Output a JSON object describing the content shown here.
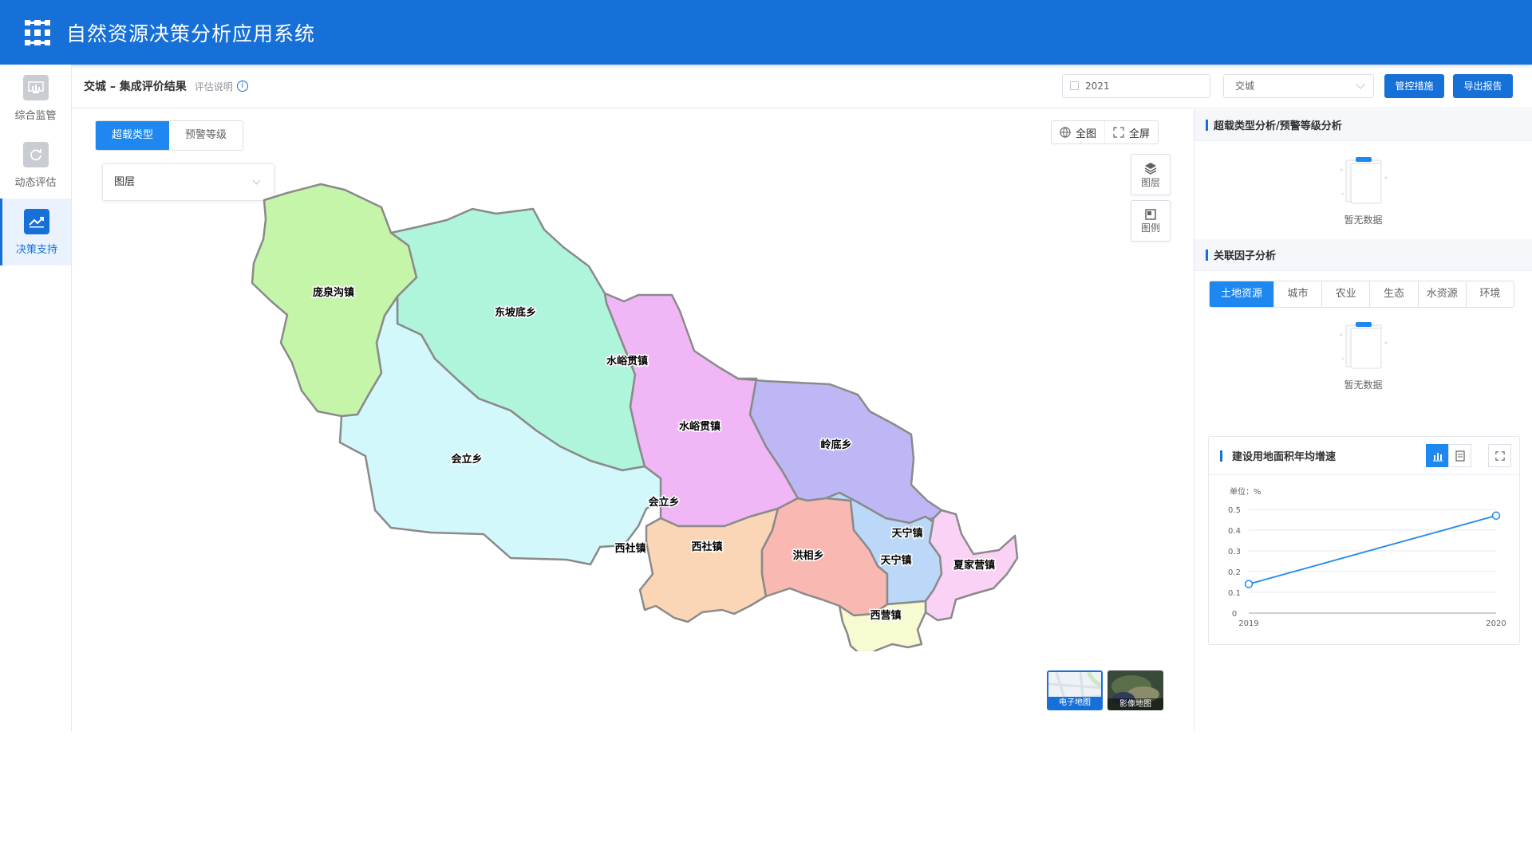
{
  "app": {
    "title": "自然资源决策分析应用系统"
  },
  "sidebar": {
    "items": [
      {
        "label": "综合监管",
        "icon": "monitor-icon",
        "active": false
      },
      {
        "label": "动态评估",
        "icon": "refresh-icon",
        "active": false
      },
      {
        "label": "决策支持",
        "icon": "trend-icon",
        "active": true
      }
    ]
  },
  "subheader": {
    "breadcrumb": "交城 – 集成评价结果",
    "hint": "评估说明",
    "year": "2021",
    "region": "交城",
    "control_button": "管控措施",
    "export_button": "导出报告"
  },
  "map": {
    "tabs": [
      "超载类型",
      "预警等级"
    ],
    "active_tab": "超载类型",
    "layer_select": "图层",
    "ctrl_full_extent": "全图",
    "ctrl_fullscreen": "全屏",
    "tool_layers": "图层",
    "tool_legend": "图例",
    "basemap_vector": "电子地图",
    "basemap_imagery": "影像地图",
    "regions": [
      {
        "name": "庞泉沟镇",
        "color": "#c5f5a8"
      },
      {
        "name": "东坡底乡",
        "color": "#aef5dc"
      },
      {
        "name": "水峪贯镇",
        "color": "#f0b6f5"
      },
      {
        "name": "会立乡",
        "color": "#d2f8fb"
      },
      {
        "name": "岭底乡",
        "color": "#bdb8f5"
      },
      {
        "name": "西社镇",
        "color": "#fbd6b6"
      },
      {
        "name": "洪相乡",
        "color": "#fab8b3"
      },
      {
        "name": "天宁镇",
        "color": "#bcd8f8"
      },
      {
        "name": "夏家营镇",
        "color": "#fad2f6"
      },
      {
        "name": "西营镇",
        "color": "#f8fad2"
      }
    ],
    "labels": [
      "庞泉沟镇",
      "东坡底乡",
      "水峪贯镇",
      "水峪贯镇",
      "会立乡",
      "会立乡",
      "岭底乡",
      "西社镇",
      "西社镇",
      "洪相乡",
      "天宁镇",
      "天宁镇",
      "夏家营镇",
      "西营镇"
    ]
  },
  "right_panel": {
    "overload_title": "超载类型分析/预警等级分析",
    "no_data": "暂无数据",
    "factor_title": "关联因子分析",
    "factor_tabs": [
      "土地资源",
      "城市",
      "农业",
      "生态",
      "水资源",
      "环境"
    ],
    "active_factor": "土地资源",
    "chart_title": "建设用地面积年均增速"
  },
  "chart_data": {
    "type": "line",
    "title": "建设用地面积年均增速",
    "ylabel": "单位：%",
    "categories": [
      "2019",
      "2020"
    ],
    "series": [
      {
        "values": [
          0.14,
          0.47
        ]
      }
    ],
    "ylim": [
      0,
      0.5
    ],
    "yticks": [
      "0",
      "0.1",
      "0.2",
      "0.3",
      "0.4",
      "0.5"
    ],
    "grid": true,
    "color": "#1e88f0"
  }
}
